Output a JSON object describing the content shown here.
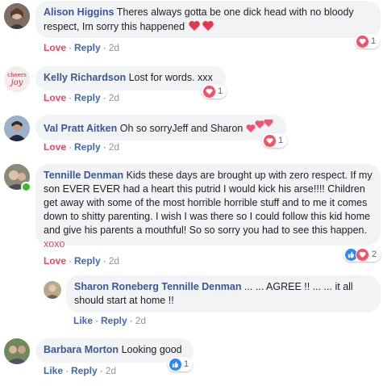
{
  "comments": [
    {
      "author": "Alison Higgins",
      "text": "Theres always gotta be one dick head with no bloody respect, Im sorry this happened",
      "inline_emoji": [
        "red-heart",
        "red-heart"
      ],
      "actions": {
        "primary": "Love",
        "reply": "Reply",
        "time": "2d"
      },
      "reaction_count": "1"
    },
    {
      "author": "Kelly Richardson",
      "avatar_text": [
        "cheers",
        "joy"
      ],
      "text": "Lost for words. xxx",
      "actions": {
        "primary": "Love",
        "reply": "Reply",
        "time": "2d"
      },
      "reaction_count": "1"
    },
    {
      "author": "Val Pratt Aitken",
      "text": "Oh so sorryJeff and Sharon",
      "inline_emoji": [
        "heart-face",
        "heart-face",
        "heart-face"
      ],
      "actions": {
        "primary": "Love",
        "reply": "Reply",
        "time": "2d"
      },
      "reaction_count": "1"
    },
    {
      "author": "Tennille Denman",
      "text": "Kids these days are brought up with zero respect. If my son EVER EVER had a heart this putrid I would kick his arse!!!! Children get away with some of the most horrible horrible stuff and to me it comes down to shitty parenting. I wish I was there so I could follow this kid home and give his parents a mouthful! So so sorry you had to see this happen.",
      "signoff": "xoxo",
      "actions": {
        "primary": "Love",
        "reply": "Reply",
        "time": "2d"
      },
      "reaction_count": "2"
    },
    {
      "author": "Sharon Roneberg",
      "tagged": "Tennille Denman",
      "text": "... ... AGREE !! ... ... it all should start at home !!",
      "actions": {
        "primary": "Like",
        "reply": "Reply",
        "time": "2d"
      }
    },
    {
      "author": "Barbara Morton",
      "text": "Looking good",
      "actions": {
        "primary": "Like",
        "reply": "Reply",
        "time": "2d"
      },
      "reaction_count": "1"
    }
  ],
  "colors": {
    "author": "#385898",
    "love": "#e8475f",
    "like": "#4267b2",
    "bubble": "#f2f3f5"
  }
}
